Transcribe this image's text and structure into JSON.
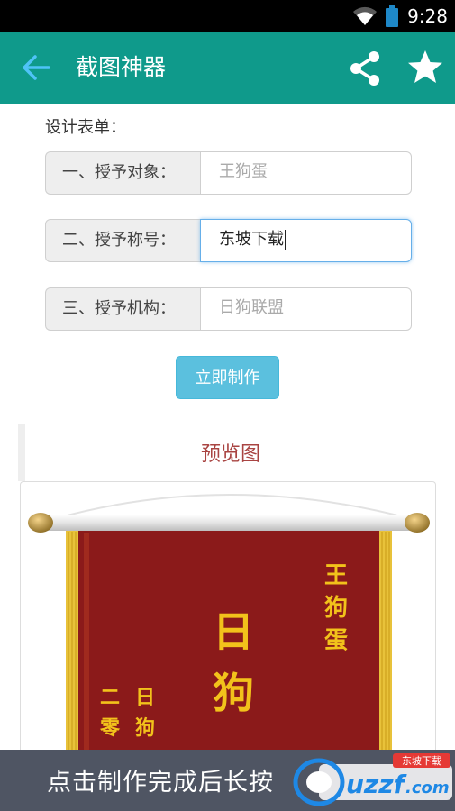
{
  "status_bar": {
    "time": "9:28",
    "icons": [
      "wifi-icon",
      "battery-icon"
    ]
  },
  "app_bar": {
    "title": "截图神器",
    "back_icon": "arrow-left-icon",
    "share_icon": "share-icon",
    "favorite_icon": "star-icon"
  },
  "form": {
    "heading": "设计表单：",
    "rows": [
      {
        "label": "一、授予对象：",
        "value": "",
        "placeholder": "王狗蛋"
      },
      {
        "label": "二、授予称号：",
        "value": "东坡下载",
        "placeholder": ""
      },
      {
        "label": "三、授予机构：",
        "value": "",
        "placeholder": "日狗联盟"
      }
    ],
    "submit_label": "立即制作"
  },
  "preview": {
    "heading": "预览图",
    "banner": {
      "recipient": [
        "王",
        "狗",
        "蛋"
      ],
      "title_chars": [
        "日",
        "狗"
      ],
      "org_chars": [
        "日",
        "狗"
      ],
      "date_chars": [
        "二",
        "零"
      ]
    }
  },
  "bottom_banner": {
    "message": "点击制作完成后长按",
    "logo_text": "uzzf",
    "logo_tld": ".com",
    "logo_badge": "东坡下载"
  },
  "colors": {
    "accent": "#0f9a8b",
    "button": "#5bc0de",
    "preview_title": "#a94442",
    "banner_red": "#8b1a1a",
    "banner_gold": "#f2c21b"
  }
}
